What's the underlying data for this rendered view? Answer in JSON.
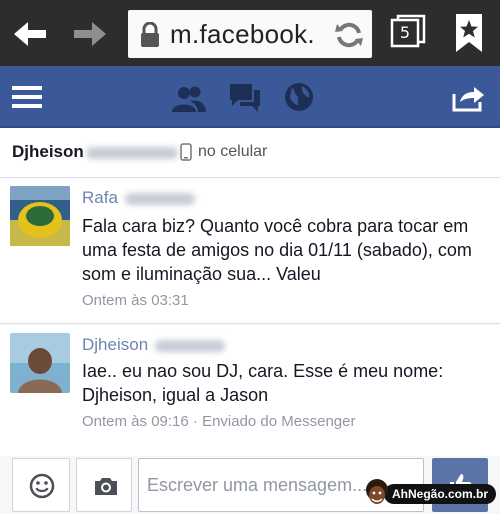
{
  "browser": {
    "url": "m.facebook.",
    "tab_count": "5",
    "icons": [
      "back-arrow-icon",
      "forward-arrow-icon",
      "lock-icon",
      "refresh-icon",
      "tabs-icon",
      "bookmark-icon"
    ]
  },
  "fb_header": {
    "icons": [
      "menu-icon",
      "friends-icon",
      "messages-icon",
      "globe-icon",
      "share-icon"
    ],
    "color": "#3b5998"
  },
  "conversation": {
    "name": "Djheison",
    "status": "no celular"
  },
  "messages": [
    {
      "sender": "Rafa",
      "text": "Fala cara biz? Quanto você cobra para tocar em uma festa de amigos no dia 01/11 (sabado), com som e iluminação sua... Valeu",
      "meta": "Ontem às 03:31"
    },
    {
      "sender": "Djheison",
      "text": "Iae.. eu nao sou DJ, cara. Esse é meu nome: Djheison, igual a Jason",
      "meta": "Ontem às 09:16 · Enviado do Messenger"
    }
  ],
  "composer": {
    "placeholder": "Escrever uma mensagem...",
    "icons": [
      "emoji-icon",
      "camera-icon",
      "like-icon"
    ]
  },
  "watermark": {
    "text": "AhNegão.com.br"
  }
}
